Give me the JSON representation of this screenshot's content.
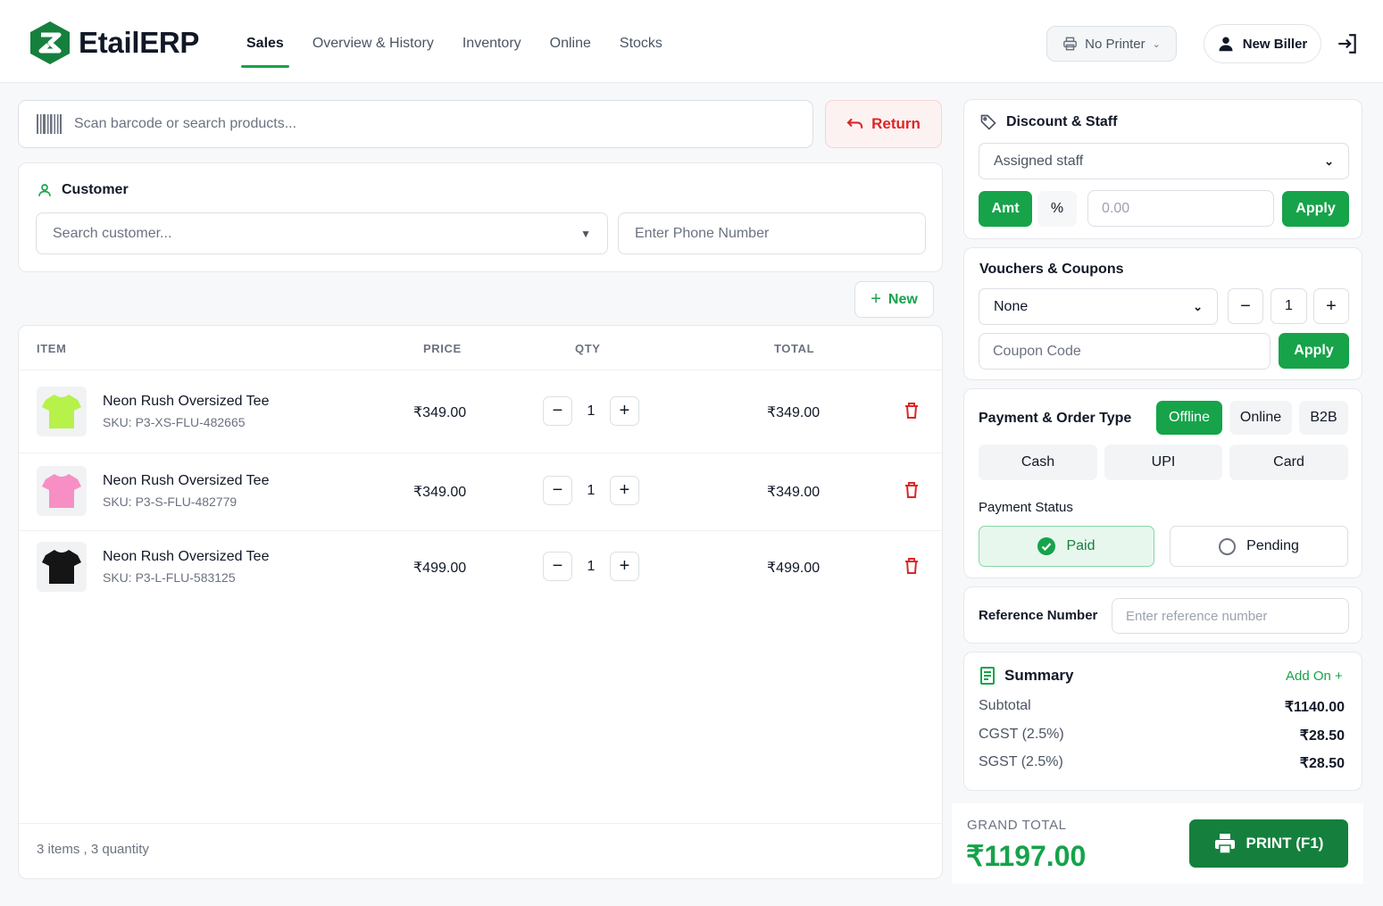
{
  "header": {
    "brand": "EtailERP",
    "nav": [
      "Sales",
      "Overview & History",
      "Inventory",
      "Online",
      "Stocks"
    ],
    "printer_label": "No Printer",
    "biller_label": "New Biller"
  },
  "search": {
    "placeholder": "Scan barcode or search products...",
    "return_label": "Return"
  },
  "customer": {
    "title": "Customer",
    "search_placeholder": "Search customer...",
    "phone_placeholder": "Enter Phone Number"
  },
  "new_label": "New",
  "table": {
    "headers": [
      "ITEM",
      "PRICE",
      "QTY",
      "TOTAL"
    ],
    "rows": [
      {
        "name": "Neon Rush Oversized Tee",
        "sku": "SKU: P3-XS-FLU-482665",
        "price": "₹349.00",
        "qty": "1",
        "total": "₹349.00",
        "color": "#b6f24a"
      },
      {
        "name": "Neon Rush Oversized Tee",
        "sku": "SKU: P3-S-FLU-482779",
        "price": "₹349.00",
        "qty": "1",
        "total": "₹349.00",
        "color": "#f78fc4"
      },
      {
        "name": "Neon Rush Oversized Tee",
        "sku": "SKU: P3-L-FLU-583125",
        "price": "₹499.00",
        "qty": "1",
        "total": "₹499.00",
        "color": "#151515"
      }
    ],
    "footer": "3 items , 3 quantity"
  },
  "discount": {
    "title": "Discount & Staff",
    "staff_select": "Assigned staff",
    "amt_label": "Amt",
    "pct_label": "%",
    "value_placeholder": "0.00",
    "apply_label": "Apply"
  },
  "vouchers": {
    "title": "Vouchers & Coupons",
    "select": "None",
    "qty": "1",
    "coupon_placeholder": "Coupon Code",
    "apply_label": "Apply"
  },
  "payment": {
    "title": "Payment & Order Type",
    "order_types": [
      "Offline",
      "Online",
      "B2B"
    ],
    "methods": [
      "Cash",
      "UPI",
      "Card"
    ],
    "status_title": "Payment Status",
    "status_paid": "Paid",
    "status_pending": "Pending"
  },
  "reference": {
    "label": "Reference Number",
    "placeholder": "Enter reference number"
  },
  "summary": {
    "title": "Summary",
    "addon_label": "Add On +",
    "subtotal_label": "Subtotal",
    "subtotal": "₹1140.00",
    "cgst_label": "CGST (2.5%)",
    "cgst": "₹28.50",
    "sgst_label": "SGST (2.5%)",
    "sgst": "₹28.50"
  },
  "grand": {
    "label": "GRAND TOTAL",
    "value": "₹1197.00",
    "print_label": "PRINT (F1)"
  },
  "colors": {
    "accent": "#16a34a",
    "danger": "#dc2626"
  }
}
